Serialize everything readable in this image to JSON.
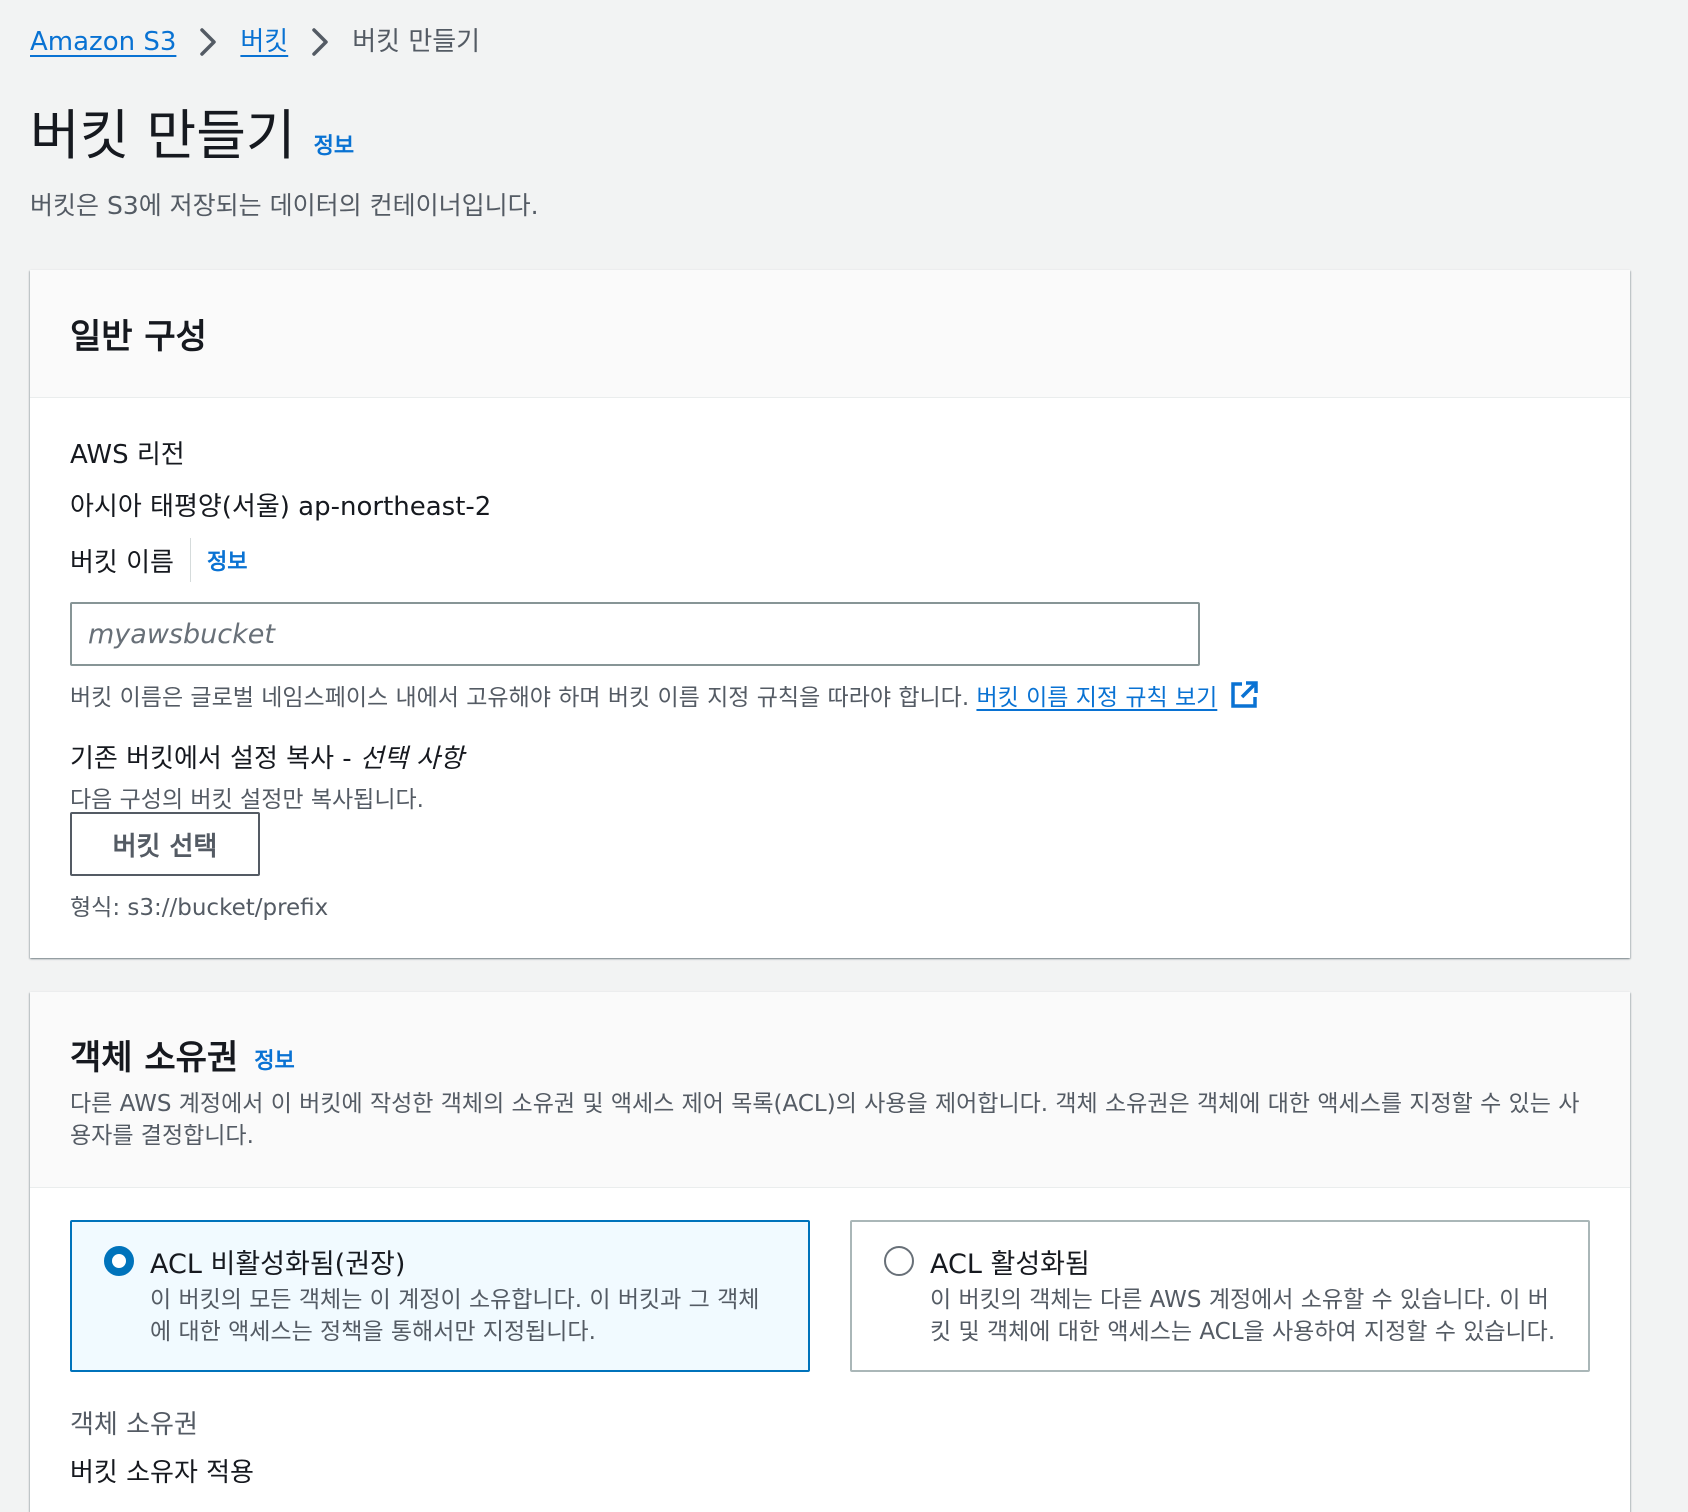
{
  "breadcrumb": {
    "items": [
      "Amazon S3",
      "버킷"
    ],
    "current": "버킷 만들기"
  },
  "header": {
    "title": "버킷 만들기",
    "info": "정보",
    "description": "버킷은 S3에 저장되는 데이터의 컨테이너입니다."
  },
  "general": {
    "title": "일반 구성",
    "region_label": "AWS 리전",
    "region_value": "아시아 태평양(서울) ap-northeast-2",
    "bucket_name_label": "버킷 이름",
    "bucket_name_info": "정보",
    "bucket_name_placeholder": "myawsbucket",
    "bucket_name_value": "",
    "bucket_name_hint": "버킷 이름은 글로벌 네임스페이스 내에서 고유해야 하며 버킷 이름 지정 규칙을 따라야 합니다.",
    "naming_rules_link": "버킷 이름 지정 규칙 보기",
    "copy_label": "기존 버킷에서 설정 복사 - ",
    "copy_optional": "선택 사항",
    "copy_desc": "다음 구성의 버킷 설정만 복사됩니다.",
    "choose_bucket_button": "버킷 선택",
    "format_hint": "형식: s3://bucket/prefix"
  },
  "ownership": {
    "title": "객체 소유권",
    "info": "정보",
    "description": "다른 AWS 계정에서 이 버킷에 작성한 객체의 소유권 및 액세스 제어 목록(ACL)의 사용을 제어합니다. 객체 소유권은 객체에 대한 액세스를 지정할 수 있는 사용자를 결정합니다.",
    "options": [
      {
        "title": "ACL 비활성화됨(권장)",
        "desc": "이 버킷의 모든 객체는 이 계정이 소유합니다. 이 버킷과 그 객체에 대한 액세스는 정책을 통해서만 지정됩니다.",
        "selected": true
      },
      {
        "title": "ACL 활성화됨",
        "desc": "이 버킷의 객체는 다른 AWS 계정에서 소유할 수 있습니다. 이 버킷 및 객체에 대한 액세스는 ACL을 사용하여 지정할 수 있습니다.",
        "selected": false
      }
    ],
    "owner_label": "객체 소유권",
    "owner_value": "버킷 소유자 적용"
  },
  "icons": {
    "breadcrumb_separator": "chevron-right-icon",
    "external_link": "external-link-icon"
  },
  "colors": {
    "link": "#0972d3",
    "selected_border": "#0073bb",
    "selected_bg": "#f1faff",
    "page_bg": "#f2f3f3"
  }
}
